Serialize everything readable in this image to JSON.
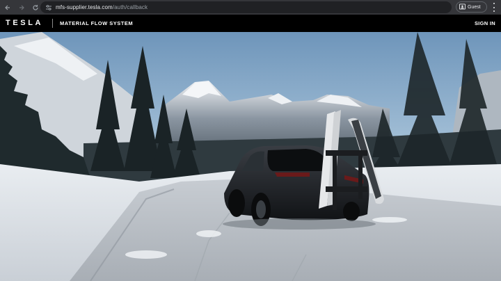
{
  "browser": {
    "url_host": "mfs-supplier.tesla.com",
    "url_path": "/auth/callback",
    "profile_label": "Guest",
    "icons": [
      "back-arrow-icon",
      "forward-arrow-icon",
      "reload-icon",
      "site-settings-icon",
      "guest-profile-icon",
      "menu-kebab-icon"
    ]
  },
  "header": {
    "logo_text": "TESLA",
    "app_title": "MATERIAL FLOW SYSTEM",
    "sign_in_label": "SIGN IN"
  },
  "hero": {
    "image_description_icon": "snowy-mountain-road-car-icon"
  },
  "colors": {
    "chrome_bg": "#35363a",
    "omnibox_bg": "#202124",
    "header_bg": "#000000",
    "text_light": "#e8eaed"
  }
}
